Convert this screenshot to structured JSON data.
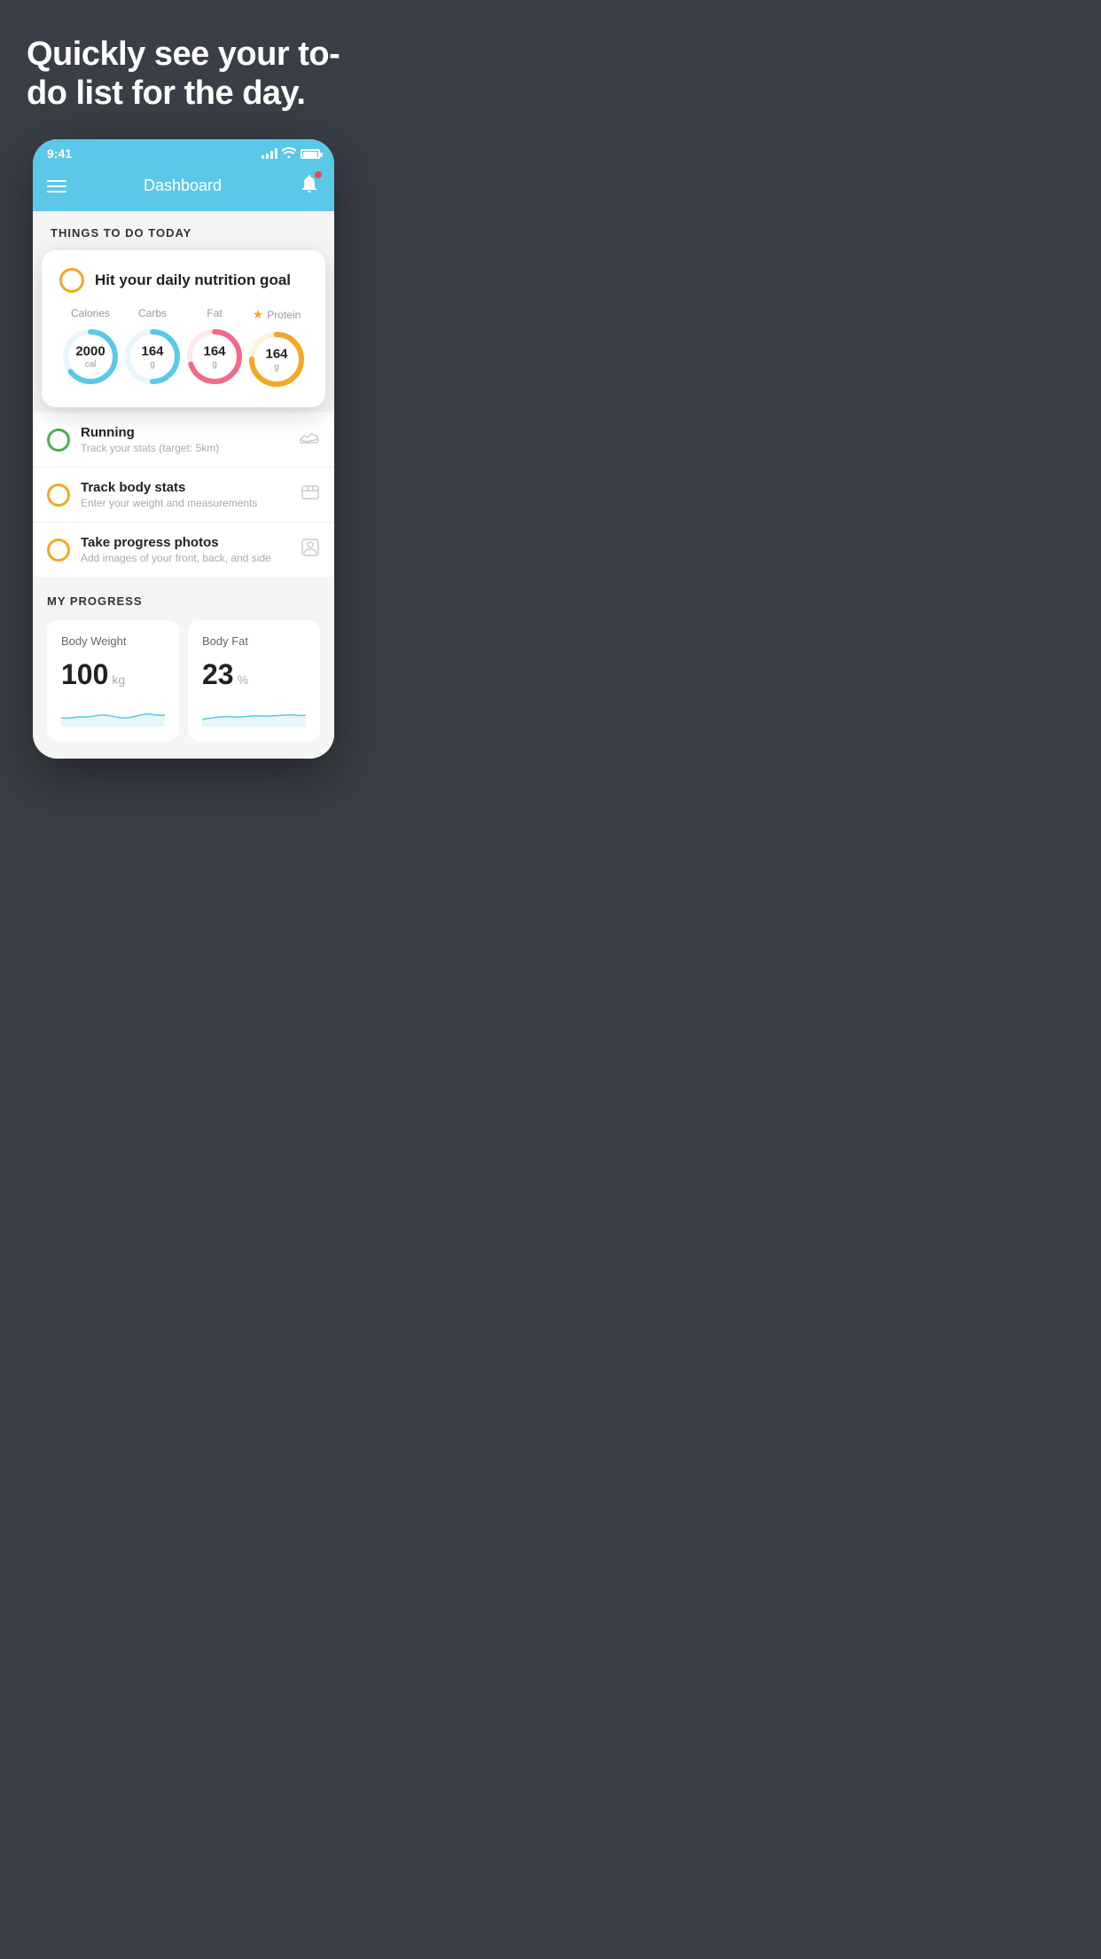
{
  "hero": {
    "title": "Quickly see your to-do list for the day."
  },
  "status_bar": {
    "time": "9:41"
  },
  "header": {
    "title": "Dashboard"
  },
  "things_to_do": {
    "section_title": "THINGS TO DO TODAY",
    "nutrition_card": {
      "title": "Hit your daily nutrition goal",
      "items": [
        {
          "label": "Calories",
          "value": "2000",
          "unit": "cal",
          "color": "#5bc8e8",
          "progress": 0.65
        },
        {
          "label": "Carbs",
          "value": "164",
          "unit": "g",
          "color": "#5bc8e8",
          "progress": 0.5
        },
        {
          "label": "Fat",
          "value": "164",
          "unit": "g",
          "color": "#f06b8a",
          "progress": 0.7
        },
        {
          "label": "Protein",
          "value": "164",
          "unit": "g",
          "color": "#f5a623",
          "progress": 0.75,
          "starred": true
        }
      ]
    },
    "list_items": [
      {
        "title": "Running",
        "subtitle": "Track your stats (target: 5km)",
        "circle_color": "green",
        "icon": "shoe"
      },
      {
        "title": "Track body stats",
        "subtitle": "Enter your weight and measurements",
        "circle_color": "yellow",
        "icon": "scale"
      },
      {
        "title": "Take progress photos",
        "subtitle": "Add images of your front, back, and side",
        "circle_color": "yellow",
        "icon": "person"
      }
    ]
  },
  "my_progress": {
    "section_title": "MY PROGRESS",
    "cards": [
      {
        "title": "Body Weight",
        "value": "100",
        "unit": "kg"
      },
      {
        "title": "Body Fat",
        "value": "23",
        "unit": "%"
      }
    ]
  }
}
